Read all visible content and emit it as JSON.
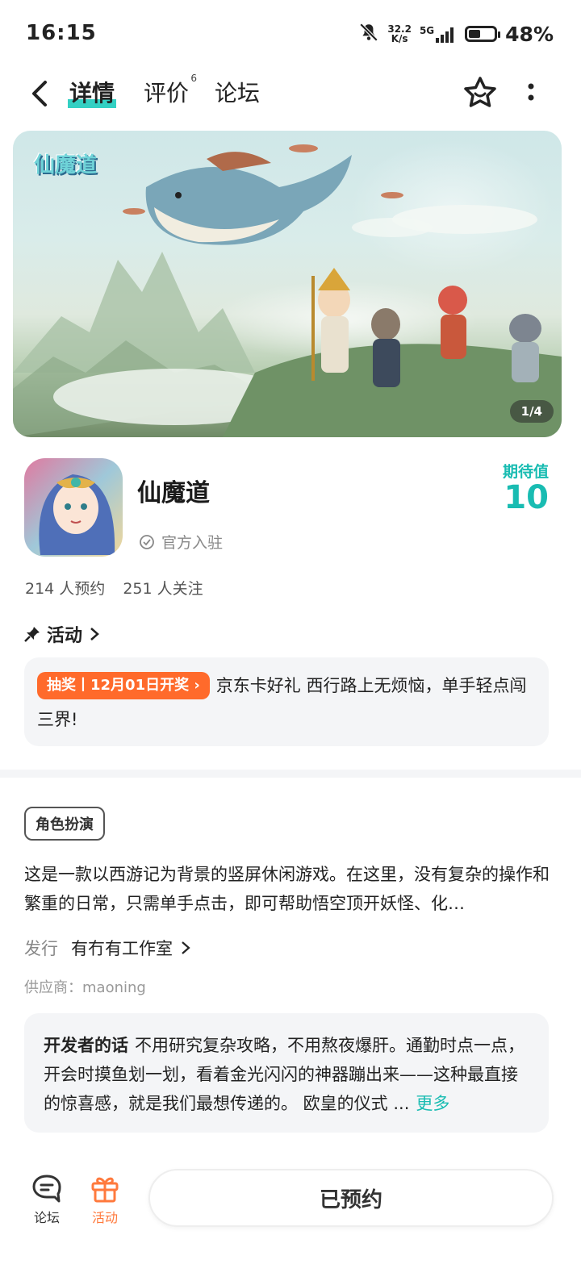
{
  "status_bar": {
    "time": "16:15",
    "net_speed_value": "32.2",
    "net_speed_unit": "K/s",
    "network": "5G",
    "battery_percent": "48%",
    "battery_level": 0.48
  },
  "nav": {
    "tabs": [
      {
        "label": "详情",
        "active": true
      },
      {
        "label": "评价",
        "badge": "6"
      },
      {
        "label": "论坛"
      }
    ]
  },
  "banner": {
    "logo_text": "仙魔道",
    "counter": "1/4"
  },
  "app": {
    "name": "仙魔道",
    "official_label": "官方入驻",
    "expect_label": "期待值",
    "expect_value": "10",
    "reservations": "214 人预约",
    "followers": "251 人关注"
  },
  "activity": {
    "header": "活动",
    "tag": "抽奖丨12月01日开奖",
    "text": "京东卡好礼 西行路上无烦恼，单手轻点闯三界!"
  },
  "details": {
    "genre": "角色扮演",
    "description": "这是一款以西游记为背景的竖屏休闲游戏。在这里，没有复杂的操作和繁重的日常，只需单手点击，即可帮助悟空顶开妖怪、化…",
    "publisher_label": "发行",
    "publisher_value": "有冇有工作室",
    "supplier": "供应商：maoning"
  },
  "developer": {
    "title": "开发者的话",
    "text": "不用研究复杂攻略，不用熬夜爆肝。通勤时点一点，开会时摸鱼划一划，看着金光闪闪的神器蹦出来——这种最直接的惊喜感，就是我们最想传递的。 欧皇的仪式 ...",
    "more": "更多"
  },
  "bottom": {
    "forum_label": "论坛",
    "activity_label": "活动",
    "reserve_label": "已预约"
  },
  "colors": {
    "accent": "#19bcb2",
    "tab_underline": "#33d0c3",
    "lottery_tag": "#ff6a2b",
    "activity_icon": "#ff7a3d"
  }
}
